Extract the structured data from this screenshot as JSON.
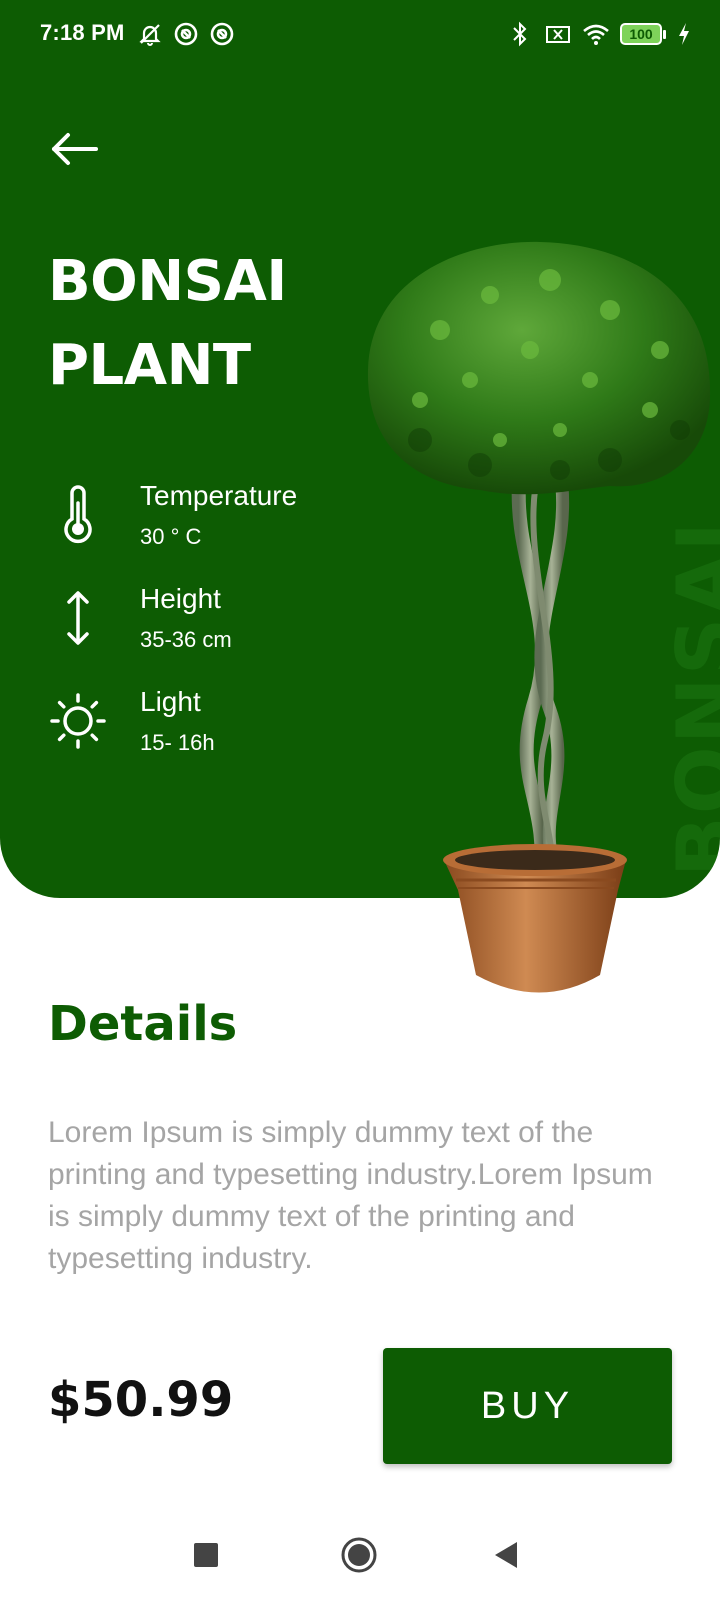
{
  "status_bar": {
    "time": "7:18 PM",
    "battery": "100",
    "left_icons": [
      "mute-bell-icon",
      "app-notification-icon",
      "app-notification-icon"
    ],
    "right_icons": [
      "bluetooth-icon",
      "no-sim-icon",
      "wifi-icon",
      "battery-icon",
      "charging-icon"
    ]
  },
  "header": {
    "back_icon": "arrow-left-icon",
    "title_line1": "BONSAI",
    "title_line2": "PLANT",
    "watermark": "BONSAI"
  },
  "specs": [
    {
      "icon": "thermometer-icon",
      "label": "Temperature",
      "value": "30 ° C"
    },
    {
      "icon": "vertical-arrows-icon",
      "label": "Height",
      "value": "35-36 cm"
    },
    {
      "icon": "sun-icon",
      "label": "Light",
      "value": "15- 16h"
    }
  ],
  "details": {
    "title": "Details",
    "text": "Lorem Ipsum is simply dummy text of the printing and typesetting industry.Lorem Ipsum is simply dummy text of the printing and typesetting industry."
  },
  "purchase": {
    "price": "$50.99",
    "buy_label": "BUY"
  },
  "nav": {
    "icons": [
      "recents-square-icon",
      "home-circle-icon",
      "back-triangle-icon"
    ]
  },
  "colors": {
    "primary_green": "#0d5c03",
    "text_gray": "#a5a5a5"
  }
}
